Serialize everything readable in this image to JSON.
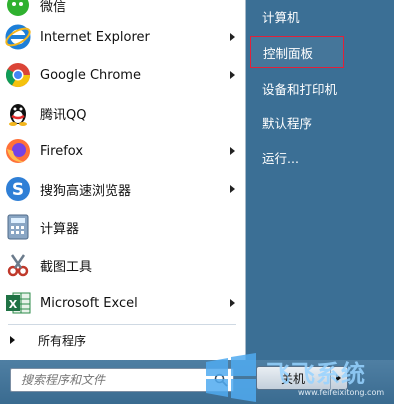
{
  "left_menu": {
    "items": [
      {
        "label": "微信",
        "icon": "wechat-icon",
        "arrow": false
      },
      {
        "label": "Internet Explorer",
        "icon": "ie-icon",
        "arrow": true
      },
      {
        "label": "Google Chrome",
        "icon": "chrome-icon",
        "arrow": true
      },
      {
        "label": "腾讯QQ",
        "icon": "qq-icon",
        "arrow": false
      },
      {
        "label": "Firefox",
        "icon": "firefox-icon",
        "arrow": true
      },
      {
        "label": "搜狗高速浏览器",
        "icon": "sogou-browser-icon",
        "arrow": true
      },
      {
        "label": "计算器",
        "icon": "calculator-icon",
        "arrow": false
      },
      {
        "label": "截图工具",
        "icon": "snipping-tool-icon",
        "arrow": false
      },
      {
        "label": "Microsoft Excel",
        "icon": "excel-icon",
        "arrow": true
      }
    ],
    "all_programs": "所有程序"
  },
  "search": {
    "placeholder": "搜索程序和文件"
  },
  "right_menu": {
    "items": [
      {
        "label": "计算机",
        "highlighted": false
      },
      {
        "label": "控制面板",
        "highlighted": true
      },
      {
        "label": "设备和打印机",
        "highlighted": false
      },
      {
        "label": "默认程序",
        "highlighted": false
      },
      {
        "label": "运行...",
        "highlighted": false
      }
    ]
  },
  "shutdown": {
    "label": "关机"
  },
  "watermark": {
    "brand": "飞飞系统",
    "url": "www.feifeixitong.com"
  },
  "colors": {
    "highlight_border": "#e0213a",
    "right_pane": "#3b6f95"
  }
}
